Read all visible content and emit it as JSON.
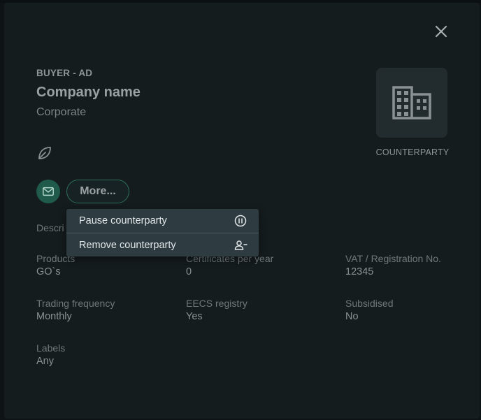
{
  "header": {
    "kicker": "BUYER - AD",
    "title": "Company name",
    "subtitle": "Corporate"
  },
  "avatar": {
    "caption": "COUNTERPARTY"
  },
  "actions": {
    "more_label": "More..."
  },
  "menu": {
    "items": [
      {
        "label": "Pause counterparty",
        "icon": "pause-circle-icon"
      },
      {
        "label": "Remove counterparty",
        "icon": "person-remove-icon"
      }
    ]
  },
  "fields": {
    "description": {
      "label": "Descri"
    },
    "products": {
      "label": "Products",
      "value": "GO`s"
    },
    "certificates": {
      "label": "Certificates per year",
      "value": "0"
    },
    "vat": {
      "label": "VAT / Registration No.",
      "value": "12345"
    },
    "trading": {
      "label": "Trading frequency",
      "value": "Monthly"
    },
    "eecs": {
      "label": "EECS registry",
      "value": "Yes"
    },
    "subsidised": {
      "label": "Subsidised",
      "value": "No"
    },
    "labels": {
      "label": "Labels",
      "value": "Any"
    }
  },
  "colors": {
    "background": "#151c1e",
    "accent": "#1f5a4a",
    "menu": "#2e3c41"
  }
}
